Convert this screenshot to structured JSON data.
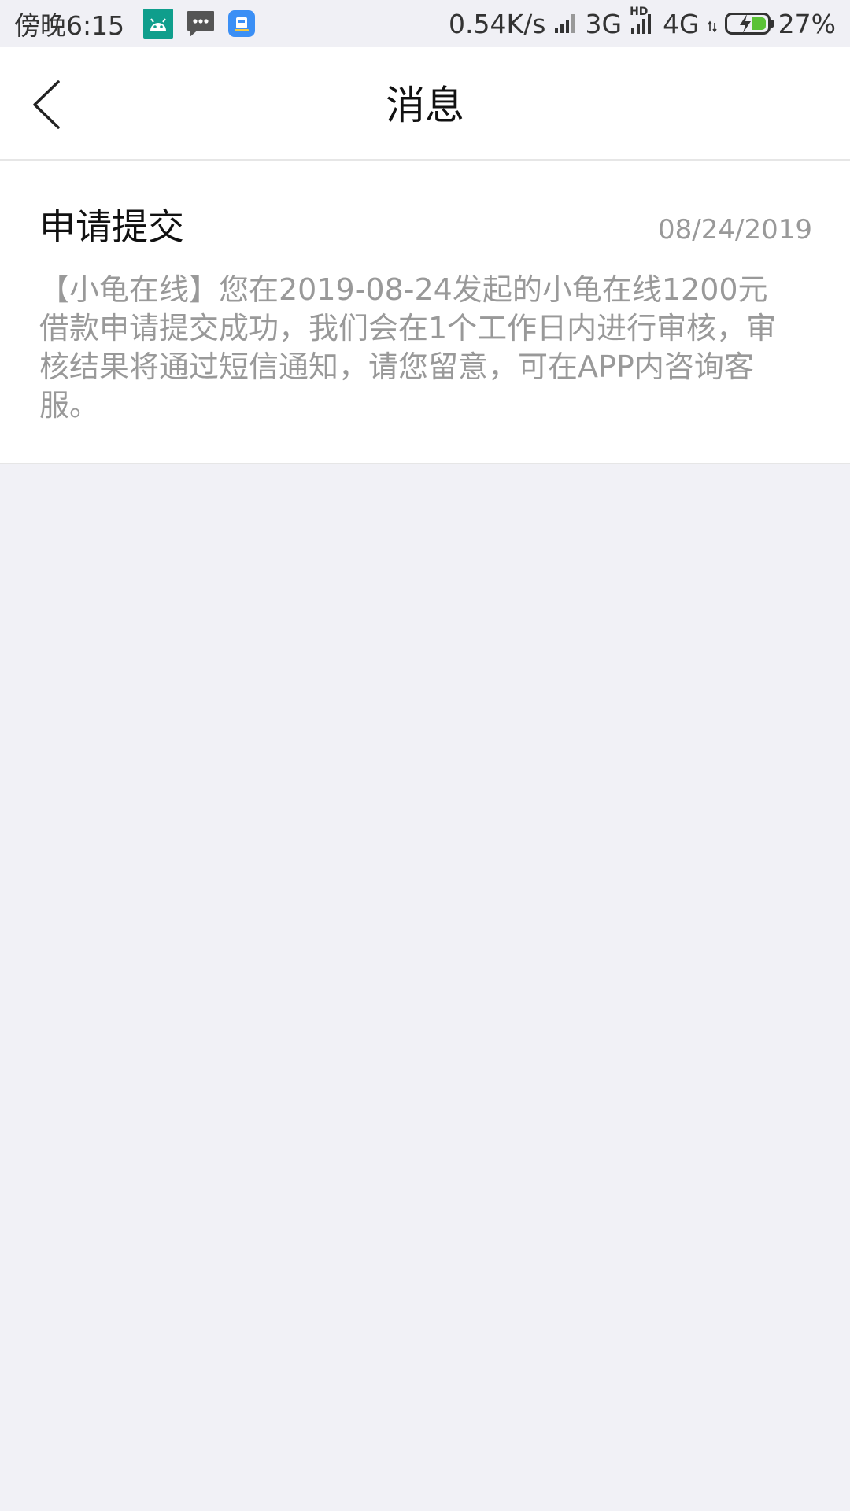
{
  "status_bar": {
    "time": "傍晚6:15",
    "net_speed": "0.54K/s",
    "network_3g": "3G",
    "hd_label": "HD",
    "network_4g": "4G",
    "battery_percent": "27%",
    "battery_level": 0.27,
    "battery_color": "#5bc236",
    "notification_icons": [
      "android-app-icon",
      "message-icon",
      "blue-app-icon"
    ]
  },
  "nav": {
    "title": "消息",
    "back_icon": "chevron-left-icon"
  },
  "messages": [
    {
      "title": "申请提交",
      "date": "08/24/2019",
      "body": "【小龟在线】您在2019-08-24发起的小龟在线1200元借款申请提交成功，我们会在1个工作日内进行审核，审核结果将通过短信通知，请您留意，可在APP内咨询客服。"
    }
  ],
  "colors": {
    "background": "#f1f1f6",
    "card": "#ffffff",
    "text_primary": "#111111",
    "text_secondary": "#999999"
  }
}
